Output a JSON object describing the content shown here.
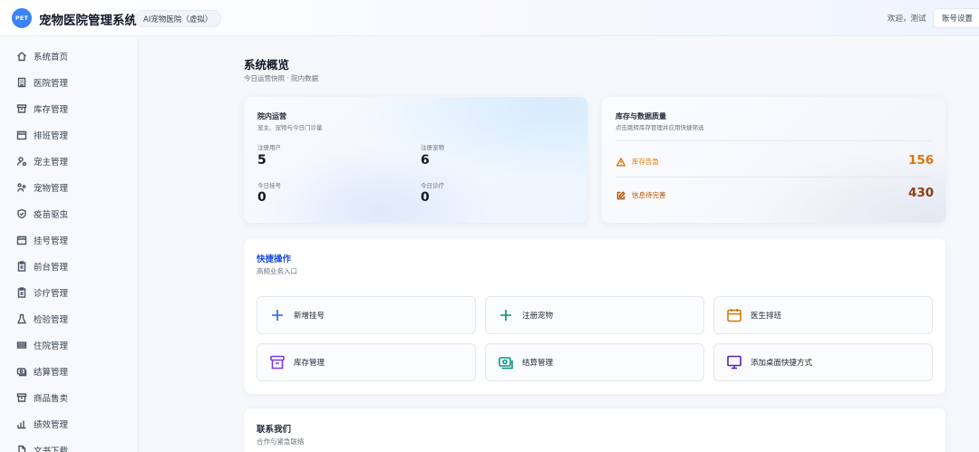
{
  "header": {
    "logo_text": "PET",
    "app_title": "宠物医院管理系统",
    "hospital_badge": "AI宠物医院（虚拟）",
    "welcome": "欢迎，测试",
    "account_button": "账号设置"
  },
  "sidebar": {
    "items": [
      {
        "label": "系统首页",
        "icon": "home-icon"
      },
      {
        "label": "医院管理",
        "icon": "building-icon"
      },
      {
        "label": "库存管理",
        "icon": "archive-icon"
      },
      {
        "label": "排班管理",
        "icon": "calendar-icon"
      },
      {
        "label": "宠主管理",
        "icon": "user-cog-icon"
      },
      {
        "label": "宠物管理",
        "icon": "paw-icon"
      },
      {
        "label": "疫苗驱虫",
        "icon": "shield-icon"
      },
      {
        "label": "挂号管理",
        "icon": "calendar-icon"
      },
      {
        "label": "前台管理",
        "icon": "clipboard-icon"
      },
      {
        "label": "诊疗管理",
        "icon": "clipboard-icon"
      },
      {
        "label": "检验管理",
        "icon": "flask-icon"
      },
      {
        "label": "住院管理",
        "icon": "bed-icon"
      },
      {
        "label": "结算管理",
        "icon": "money-icon"
      },
      {
        "label": "商品售卖",
        "icon": "archive-icon"
      },
      {
        "label": "绩效管理",
        "icon": "bar-chart-icon"
      },
      {
        "label": "文书下载",
        "icon": "file-icon"
      }
    ]
  },
  "main": {
    "title": "系统概览",
    "subtitle": "今日运营快照 · 院内数据"
  },
  "operations": {
    "title": "院内运营",
    "subtitle": "宠主、宠物与今日门诊量",
    "stats": [
      {
        "label": "注册用户",
        "value": "5"
      },
      {
        "label": "注册宠物",
        "value": "6"
      },
      {
        "label": "今日挂号",
        "value": "0"
      },
      {
        "label": "今日诊疗",
        "value": "0"
      }
    ]
  },
  "inventory": {
    "title": "库存与数据质量",
    "subtitle": "点击跳转库存管理并应用快捷筛选",
    "rows": [
      {
        "label": "库存告急",
        "value": "156",
        "color": "#d97706",
        "icon": "warning-icon"
      },
      {
        "label": "信息待完善",
        "value": "430",
        "color": "#b45309",
        "icon": "edit-icon"
      }
    ]
  },
  "quick_actions": {
    "title": "快捷操作",
    "subtitle": "高频业务入口",
    "buttons": [
      {
        "label": "新增挂号",
        "icon": "plus-icon",
        "color": "#2563eb"
      },
      {
        "label": "注册宠物",
        "icon": "plus-icon",
        "color": "#059669"
      },
      {
        "label": "医生排班",
        "icon": "calendar-icon",
        "color": "#d97706"
      },
      {
        "label": "库存管理",
        "icon": "archive-icon",
        "color": "#7c3aed"
      },
      {
        "label": "结算管理",
        "icon": "money-icon",
        "color": "#0d9488"
      },
      {
        "label": "添加桌面快捷方式",
        "icon": "monitor-icon",
        "color": "#5b21b6"
      }
    ]
  },
  "contact": {
    "title": "联系我们",
    "subtitle": "合作与紧急联络"
  }
}
